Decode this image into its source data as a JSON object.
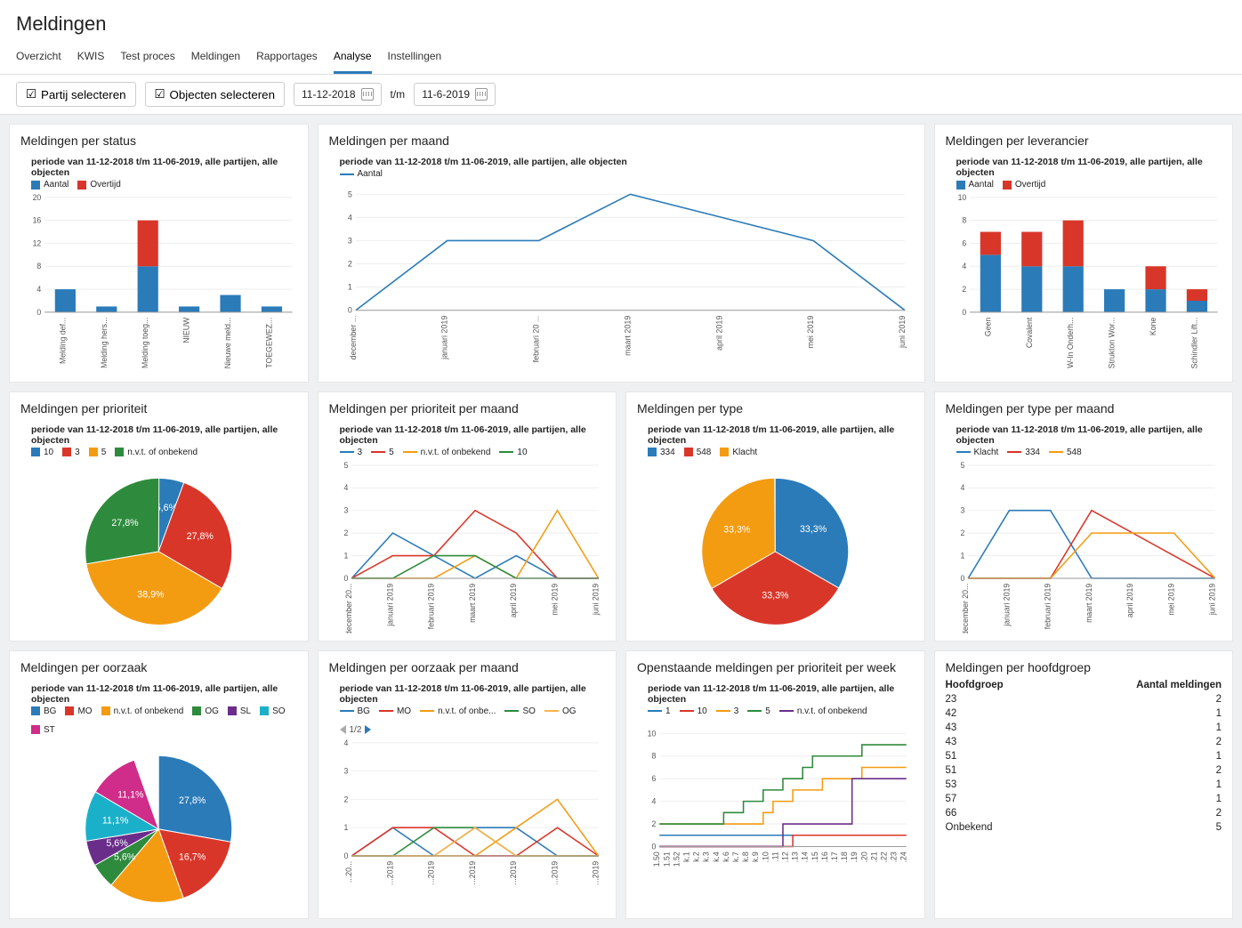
{
  "page_title": "Meldingen",
  "tabs": [
    "Overzicht",
    "KWIS",
    "Test proces",
    "Meldingen",
    "Rapportages",
    "Analyse",
    "Instellingen"
  ],
  "active_tab": "Analyse",
  "filters": {
    "partij": "Partij selecteren",
    "objecten": "Objecten selecteren",
    "date_from": "11-12-2018",
    "tm": "t/m",
    "date_to": "11-6-2019"
  },
  "period_text": "periode van 11-12-2018 t/m 11-06-2019, alle partijen, alle objecten",
  "colors": {
    "blue": "#2b7bb9",
    "red": "#d9362a",
    "orange": "#f39c12",
    "green": "#2e8b3d",
    "darkgreen": "#0c7a3b",
    "cyan": "#1bb0c9",
    "purple": "#6a2e8a",
    "magenta": "#d02c8a",
    "lightorange": "#ffb347"
  },
  "titles": {
    "status": "Meldingen per status",
    "maand": "Meldingen per maand",
    "leverancier": "Meldingen per leverancier",
    "prioriteit": "Meldingen per prioriteit",
    "prioriteit_maand": "Meldingen per prioriteit per maand",
    "type": "Meldingen per type",
    "type_maand": "Meldingen per type per maand",
    "oorzaak": "Meldingen per oorzaak",
    "oorzaak_maand": "Meldingen per oorzaak per maand",
    "openstaand": "Openstaande meldingen per prioriteit per week",
    "hoofdgroep": "Meldingen per hoofdgroep"
  },
  "legends": {
    "aantal_overtijd": [
      "Aantal",
      "Overtijd"
    ],
    "aantal": [
      "Aantal"
    ],
    "prioriteit": [
      "10",
      "3",
      "5",
      "n.v.t. of onbekend"
    ],
    "prioriteit_maand": [
      "3",
      "5",
      "n.v.t. of onbekend",
      "10"
    ],
    "type": [
      "334",
      "548",
      "Klacht"
    ],
    "type_maand": [
      "Klacht",
      "334",
      "548"
    ],
    "oorzaak": [
      "BG",
      "MO",
      "n.v.t. of onbekend",
      "OG",
      "SL",
      "SO",
      "ST"
    ],
    "oorzaak_maand": [
      "BG",
      "MO",
      "n.v.t. of onbe...",
      "SO",
      "OG"
    ],
    "openstaand": [
      "1",
      "10",
      "3",
      "5",
      "n.v.t. of onbekend"
    ]
  },
  "hoofdgroep": {
    "headers": [
      "Hoofdgroep",
      "Aantal meldingen"
    ],
    "rows": [
      [
        "23",
        "2"
      ],
      [
        "42",
        "1"
      ],
      [
        "43",
        "1"
      ],
      [
        "43",
        "2"
      ],
      [
        "51",
        "1"
      ],
      [
        "51",
        "2"
      ],
      [
        "53",
        "1"
      ],
      [
        "57",
        "1"
      ],
      [
        "66",
        "2"
      ],
      [
        "Onbekend",
        "5"
      ]
    ]
  },
  "pager": "1/2",
  "chart_data": [
    {
      "id": "status",
      "type": "stacked-bar",
      "ylim": [
        0,
        20
      ],
      "yticks": [
        0,
        4,
        8,
        12,
        16,
        20
      ],
      "categories": [
        "Melding def...",
        "Melding hers...",
        "Melding toeg...",
        "NIEUW",
        "Nieuwe meld...",
        "TOEGEWEZ..."
      ],
      "series": [
        {
          "name": "Aantal",
          "color": "#2b7bb9",
          "values": [
            4,
            1,
            8,
            1,
            3,
            1
          ]
        },
        {
          "name": "Overtijd",
          "color": "#d9362a",
          "values": [
            0,
            0,
            8,
            0,
            0,
            0
          ]
        }
      ]
    },
    {
      "id": "maand",
      "type": "line",
      "ylim": [
        0,
        5
      ],
      "yticks": [
        0,
        1,
        2,
        3,
        4,
        5
      ],
      "categories": [
        "december ...",
        "januari 2019",
        "februari 20 ...",
        "maart 2019",
        "april 2019",
        "mei 2019",
        "juni 2019"
      ],
      "series": [
        {
          "name": "Aantal",
          "color": "#2b7bb9",
          "values": [
            0,
            3,
            3,
            5,
            4,
            3,
            0
          ]
        }
      ]
    },
    {
      "id": "leverancier",
      "type": "stacked-bar",
      "ylim": [
        0,
        10
      ],
      "yticks": [
        0,
        2,
        4,
        6,
        8,
        10
      ],
      "categories": [
        "Geen",
        "Covalent",
        "W-In Onderh...",
        "Strukton Wor...",
        "Kone",
        "Schindler Lift..."
      ],
      "series": [
        {
          "name": "Aantal",
          "color": "#2b7bb9",
          "values": [
            5,
            4,
            4,
            2,
            2,
            1
          ]
        },
        {
          "name": "Overtijd",
          "color": "#d9362a",
          "values": [
            2,
            3,
            4,
            0,
            2,
            1
          ]
        }
      ]
    },
    {
      "id": "prioriteit",
      "type": "pie",
      "series": [
        {
          "name": "10",
          "color": "#2b7bb9",
          "value": 5.6
        },
        {
          "name": "3",
          "color": "#d9362a",
          "value": 27.8
        },
        {
          "name": "5",
          "color": "#f39c12",
          "value": 38.9
        },
        {
          "name": "n.v.t. of onbekend",
          "color": "#2e8b3d",
          "value": 27.8
        }
      ],
      "labels": [
        "5,6%",
        "27,8%",
        "38,9%",
        "27,8%"
      ]
    },
    {
      "id": "prioriteit_maand",
      "type": "line",
      "ylim": [
        0,
        5
      ],
      "yticks": [
        0,
        1,
        2,
        3,
        4,
        5
      ],
      "categories": [
        "december 20...",
        "januari 2019",
        "februari 2019",
        "maart 2019",
        "april 2019",
        "mei 2019",
        "juni 2019"
      ],
      "series": [
        {
          "name": "3",
          "color": "#2b7bb9",
          "values": [
            0,
            2,
            1,
            0,
            1,
            0,
            0
          ]
        },
        {
          "name": "5",
          "color": "#d9362a",
          "values": [
            0,
            1,
            1,
            3,
            2,
            0,
            0
          ]
        },
        {
          "name": "n.v.t. of onbekend",
          "color": "#f39c12",
          "values": [
            0,
            0,
            0,
            1,
            0,
            3,
            0
          ]
        },
        {
          "name": "10",
          "color": "#2e8b3d",
          "values": [
            0,
            0,
            1,
            1,
            0,
            0,
            0
          ]
        }
      ]
    },
    {
      "id": "type",
      "type": "pie",
      "series": [
        {
          "name": "334",
          "color": "#2b7bb9",
          "value": 33.3
        },
        {
          "name": "548",
          "color": "#d9362a",
          "value": 33.3
        },
        {
          "name": "Klacht",
          "color": "#f39c12",
          "value": 33.3
        }
      ],
      "labels": [
        "33,3%",
        "33,3%",
        "33,3%"
      ]
    },
    {
      "id": "type_maand",
      "type": "line",
      "ylim": [
        0,
        5
      ],
      "yticks": [
        0,
        1,
        2,
        3,
        4,
        5
      ],
      "categories": [
        "december 20...",
        "januari 2019",
        "februari 2019",
        "maart 2019",
        "april 2019",
        "mei 2019",
        "juni 2019"
      ],
      "series": [
        {
          "name": "Klacht",
          "color": "#2b7bb9",
          "values": [
            0,
            3,
            3,
            0,
            0,
            0,
            0
          ]
        },
        {
          "name": "334",
          "color": "#d9362a",
          "values": [
            0,
            0,
            0,
            3,
            2,
            1,
            0
          ]
        },
        {
          "name": "548",
          "color": "#f39c12",
          "values": [
            0,
            0,
            0,
            2,
            2,
            2,
            0
          ]
        }
      ]
    },
    {
      "id": "oorzaak",
      "type": "pie",
      "series": [
        {
          "name": "BG",
          "color": "#2b7bb9",
          "value": 27.8
        },
        {
          "name": "MO",
          "color": "#d9362a",
          "value": 16.7
        },
        {
          "name": "n.v.t. of onbekend",
          "color": "#f39c12",
          "value": 16.7
        },
        {
          "name": "OG",
          "color": "#2e8b3d",
          "value": 5.6
        },
        {
          "name": "SL",
          "color": "#6a2e8a",
          "value": 5.6
        },
        {
          "name": "SO",
          "color": "#1bb0c9",
          "value": 11.1
        },
        {
          "name": "ST",
          "color": "#d02c8a",
          "value": 11.1
        }
      ],
      "labels": [
        "27,8%",
        "16,7%",
        "",
        "5,6%",
        "5,6%",
        "11,1%",
        "11,1%"
      ]
    },
    {
      "id": "oorzaak_maand",
      "type": "line",
      "ylim": [
        0,
        4
      ],
      "yticks": [
        0,
        1,
        2,
        3,
        4
      ],
      "categories": [
        "...20...",
        "...2019",
        "...2019",
        "...2019",
        "...2019",
        "...2019",
        "...2019"
      ],
      "series": [
        {
          "name": "BG",
          "color": "#2b7bb9",
          "values": [
            0,
            1,
            0,
            1,
            1,
            0,
            0
          ]
        },
        {
          "name": "MO",
          "color": "#d9362a",
          "values": [
            0,
            1,
            1,
            0,
            0,
            1,
            0
          ]
        },
        {
          "name": "n.v.t. of onbe...",
          "color": "#f39c12",
          "values": [
            0,
            0,
            0,
            0,
            1,
            2,
            0
          ]
        },
        {
          "name": "SO",
          "color": "#2e8b3d",
          "values": [
            0,
            0,
            1,
            1,
            0,
            0,
            0
          ]
        },
        {
          "name": "OG",
          "color": "#ffb347",
          "values": [
            0,
            0,
            0,
            1,
            0,
            0,
            0
          ]
        }
      ]
    },
    {
      "id": "openstaand",
      "type": "step",
      "ylim": [
        0,
        10
      ],
      "yticks": [
        0,
        2,
        4,
        6,
        8,
        10
      ],
      "categories": [
        "1.50",
        "1.51",
        "1.52",
        "k.1",
        "k.2",
        "k.3",
        "k.4",
        "k.6",
        "k.7",
        "k.8",
        "k.9",
        ".10",
        ".11",
        ".12",
        ".13",
        ".14",
        ".15",
        ".16",
        ".17",
        ".18",
        ".19",
        ".20",
        ".21",
        ".22",
        ".23",
        ".24"
      ],
      "series": [
        {
          "name": "1",
          "color": "#2b7bb9",
          "values": [
            1,
            1,
            1,
            1,
            1,
            1,
            1,
            1,
            1,
            1,
            1,
            1,
            1,
            1,
            1,
            1,
            1,
            1,
            1,
            1,
            1,
            1,
            1,
            1,
            1,
            1
          ]
        },
        {
          "name": "10",
          "color": "#d9362a",
          "values": [
            0,
            0,
            0,
            0,
            0,
            0,
            0,
            0,
            0,
            0,
            0,
            0,
            0,
            0,
            1,
            1,
            1,
            1,
            1,
            1,
            1,
            1,
            1,
            1,
            1,
            1
          ]
        },
        {
          "name": "3",
          "color": "#f39c12",
          "values": [
            2,
            2,
            2,
            2,
            2,
            2,
            2,
            2,
            2,
            2,
            2,
            3,
            4,
            4,
            5,
            5,
            5,
            6,
            6,
            6,
            6,
            7,
            7,
            7,
            7,
            7
          ]
        },
        {
          "name": "5",
          "color": "#2e8b3d",
          "values": [
            2,
            2,
            2,
            2,
            2,
            2,
            2,
            3,
            3,
            4,
            4,
            5,
            5,
            6,
            6,
            7,
            8,
            8,
            8,
            8,
            8,
            9,
            9,
            9,
            9,
            9
          ]
        },
        {
          "name": "n.v.t. of onbekend",
          "color": "#6a2e8a",
          "values": [
            0,
            0,
            0,
            0,
            0,
            0,
            0,
            0,
            0,
            0,
            0,
            0,
            0,
            2,
            2,
            2,
            2,
            2,
            2,
            2,
            6,
            6,
            6,
            6,
            6,
            6
          ]
        }
      ]
    }
  ]
}
